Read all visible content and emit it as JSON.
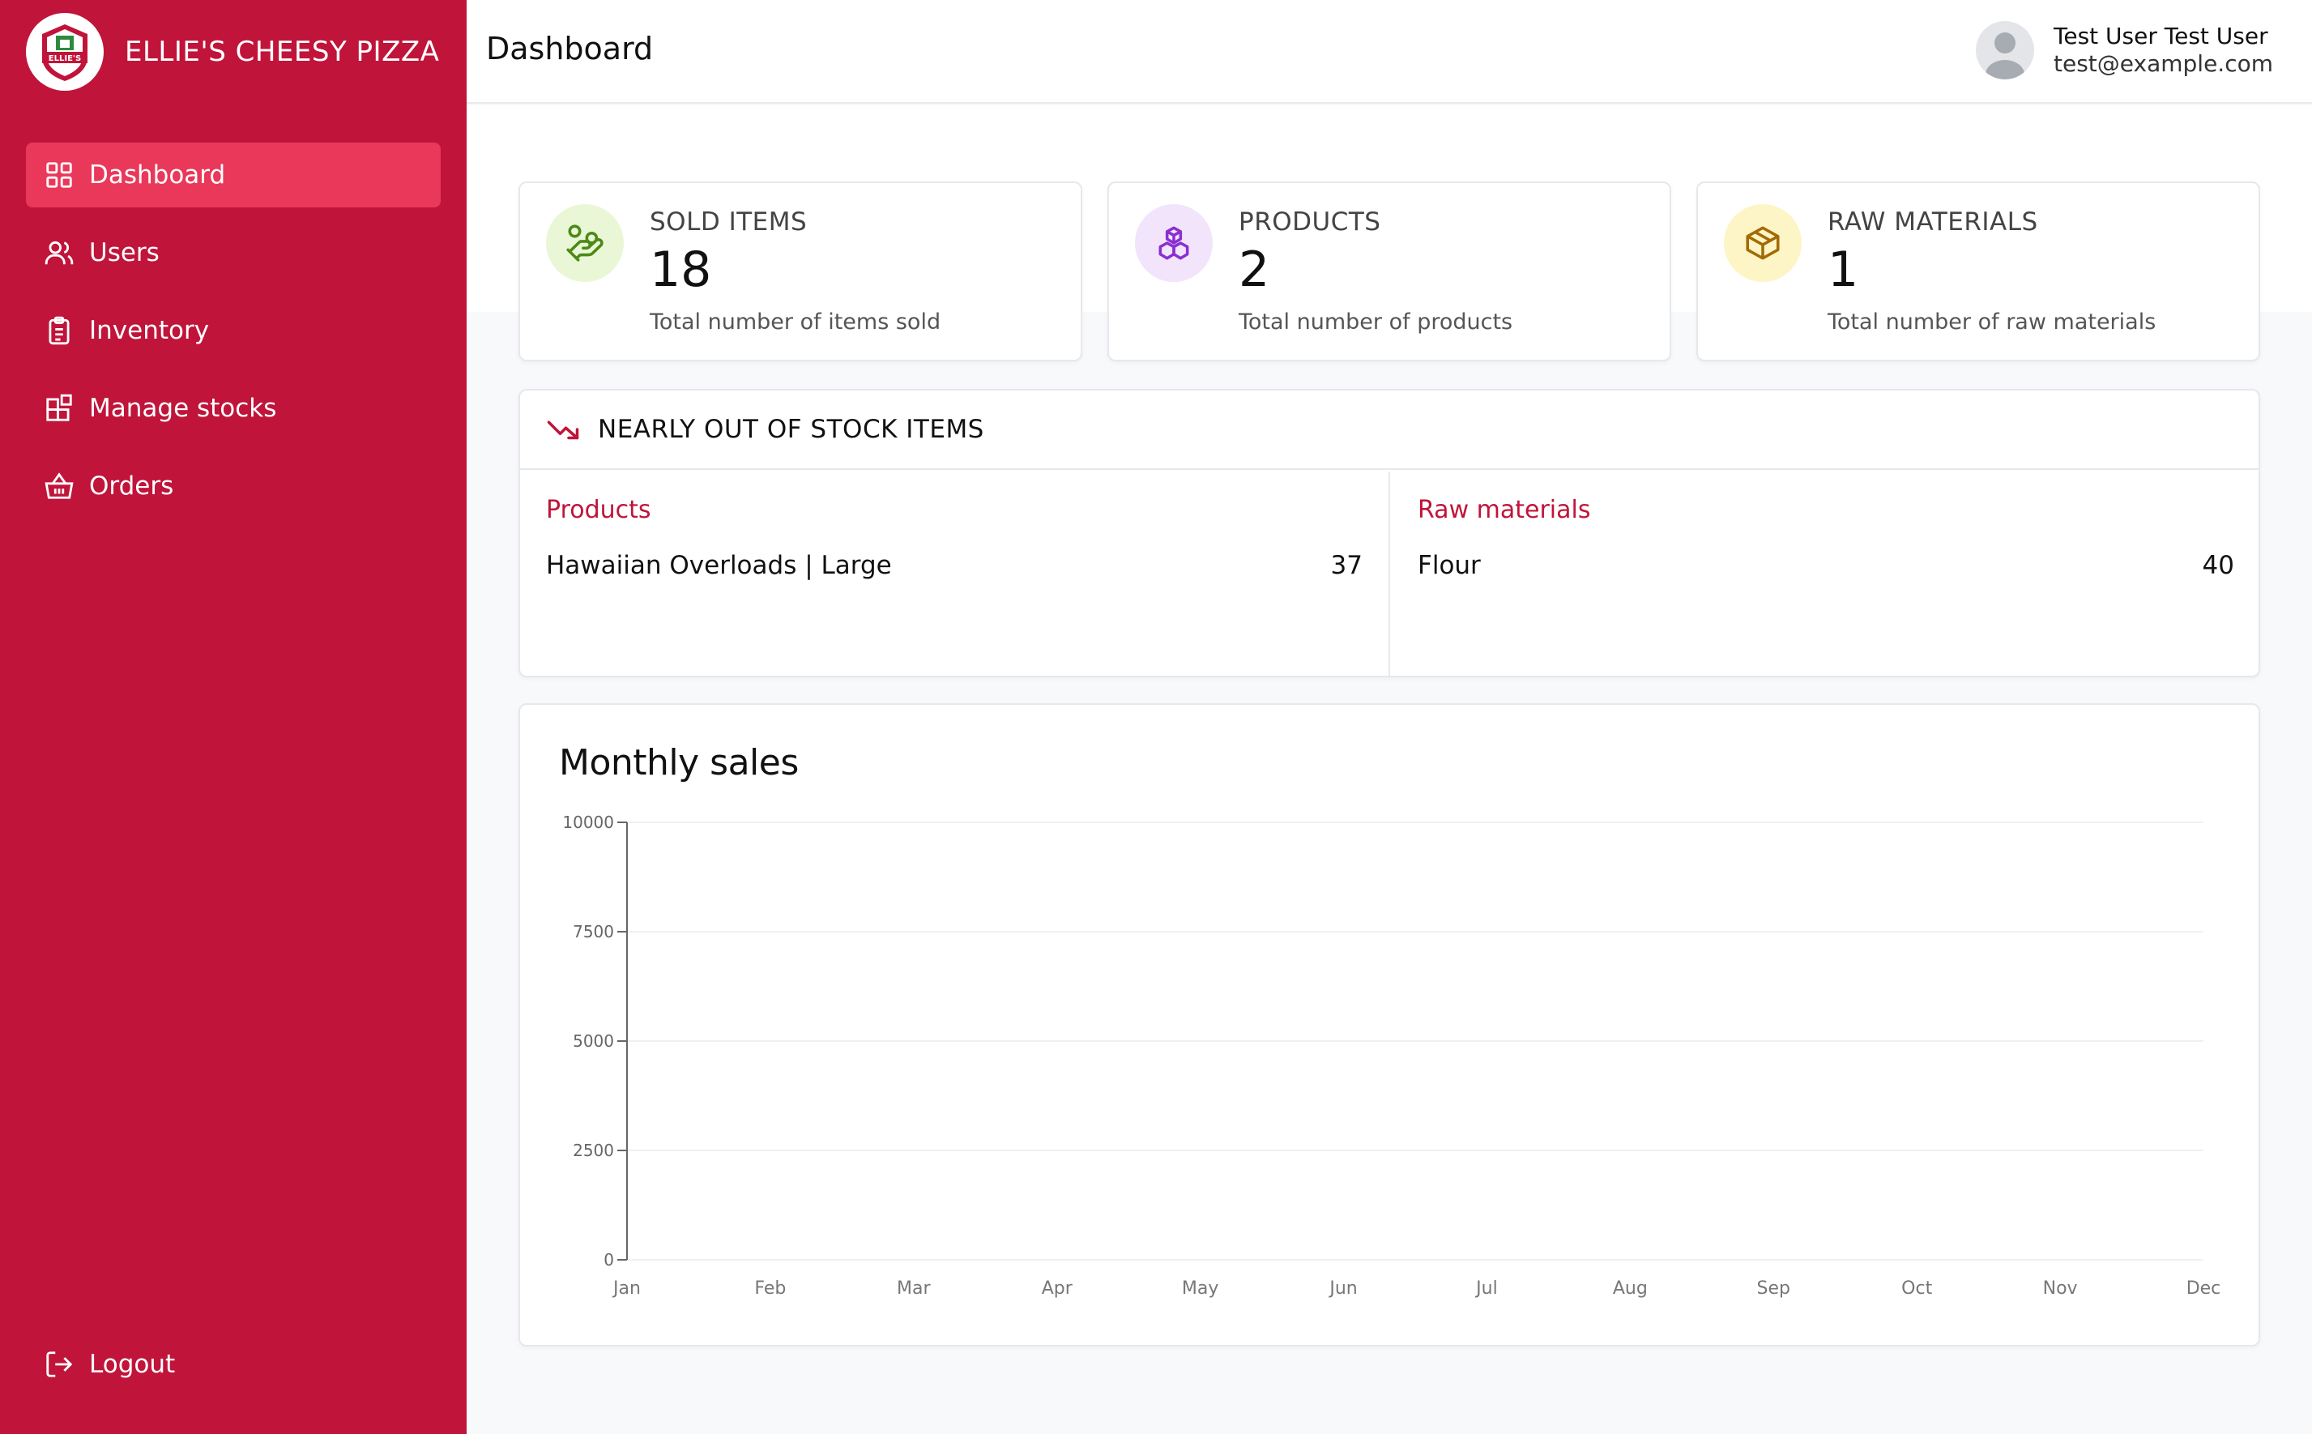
{
  "brand": {
    "name": "ELLIE'S CHEESY PIZZA",
    "logo_text": "ELLIE'S"
  },
  "colors": {
    "primary": "#c0143a",
    "active": "#e9385a",
    "sold": "#eaf7d6",
    "products": "#f1e4fb",
    "raw": "#fdf5c6"
  },
  "sidebar": {
    "items": [
      {
        "label": "Dashboard",
        "icon": "grid-icon",
        "active": true
      },
      {
        "label": "Users",
        "icon": "users-icon",
        "active": false
      },
      {
        "label": "Inventory",
        "icon": "clipboard-icon",
        "active": false
      },
      {
        "label": "Manage stocks",
        "icon": "blocks-icon",
        "active": false
      },
      {
        "label": "Orders",
        "icon": "basket-icon",
        "active": false
      }
    ],
    "logout": "Logout"
  },
  "header": {
    "title": "Dashboard",
    "user_name": "Test User Test User",
    "user_email": "test@example.com"
  },
  "stats": [
    {
      "label": "SOLD ITEMS",
      "value": "18",
      "desc": "Total number of items sold",
      "icon": "hand-coins-icon"
    },
    {
      "label": "PRODUCTS",
      "value": "2",
      "desc": "Total number of products",
      "icon": "boxes-icon"
    },
    {
      "label": "RAW MATERIALS",
      "value": "1",
      "desc": "Total number of raw materials",
      "icon": "box-icon"
    }
  ],
  "stock": {
    "title": "NEARLY OUT OF STOCK ITEMS",
    "products": {
      "title": "Products",
      "items": [
        {
          "name": "Hawaiian Overloads | Large",
          "qty": "37"
        }
      ]
    },
    "raw": {
      "title": "Raw materials",
      "items": [
        {
          "name": "Flour",
          "qty": "40"
        }
      ]
    }
  },
  "chart_data": {
    "type": "bar",
    "title": "Monthly sales",
    "categories": [
      "Jan",
      "Feb",
      "Mar",
      "Apr",
      "May",
      "Jun",
      "Jul",
      "Aug",
      "Sep",
      "Oct",
      "Nov",
      "Dec"
    ],
    "values": [
      0,
      0,
      0,
      0,
      0,
      0,
      0,
      0,
      0,
      0,
      0,
      0
    ],
    "yticks": [
      0,
      2500,
      5000,
      7500,
      10000
    ],
    "ylim": [
      0,
      10000
    ],
    "grid": true,
    "xlabel": "",
    "ylabel": ""
  }
}
